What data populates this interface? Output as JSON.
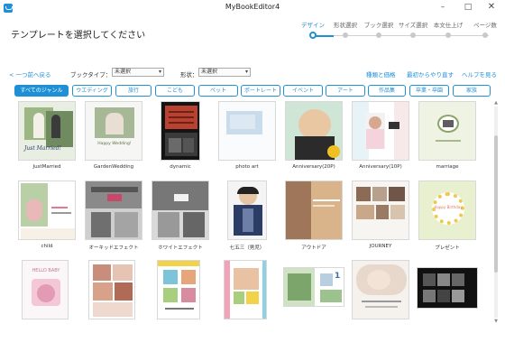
{
  "window": {
    "title": "MyBookEditor4",
    "minimize": "–",
    "maximize": "□",
    "close": "✕",
    "icon": "app-icon"
  },
  "page_title": "テンプレートを選択してください",
  "steps": [
    {
      "label": "デザイン",
      "active": true
    },
    {
      "label": "形状選択",
      "active": false
    },
    {
      "label": "ブック選択",
      "active": false
    },
    {
      "label": "サイズ選択",
      "active": false
    },
    {
      "label": "本文仕上げ",
      "active": false
    },
    {
      "label": "ページ数",
      "active": false
    }
  ],
  "toolbar": {
    "back": "< 一つ前へ戻る",
    "book_type_label": "ブックタイプ：",
    "book_type_value": "未選択",
    "shape_label": "形状：",
    "shape_value": "未選択",
    "link_price": "種類と価格",
    "link_redo": "最初からやり直す",
    "link_help": "ヘルプを見る"
  },
  "genres": [
    {
      "label": "すべてのジャンル",
      "active": true
    },
    {
      "label": "ウエディング",
      "active": false
    },
    {
      "label": "旅行",
      "active": false
    },
    {
      "label": "こども",
      "active": false
    },
    {
      "label": "ペット",
      "active": false
    },
    {
      "label": "ポートレート",
      "active": false
    },
    {
      "label": "イベント",
      "active": false
    },
    {
      "label": "アート",
      "active": false
    },
    {
      "label": "作品集",
      "active": false
    },
    {
      "label": "卒業・卒園",
      "active": false
    },
    {
      "label": "家族",
      "active": false
    }
  ],
  "templates": [
    {
      "name": "JustMarried",
      "thumb_text": "Just Married!"
    },
    {
      "name": "GardenWedding",
      "thumb_text": "Happy Wedding!"
    },
    {
      "name": "dynamic",
      "thumb_text": ""
    },
    {
      "name": "photo art",
      "thumb_text": ""
    },
    {
      "name": "Anniversary(20P)",
      "thumb_text": ""
    },
    {
      "name": "Anniversary(10P)",
      "thumb_text": ""
    },
    {
      "name": "marriage",
      "thumb_text": ""
    },
    {
      "name": "child",
      "thumb_text": ""
    },
    {
      "name": "オーキッドエフェクト",
      "thumb_text": ""
    },
    {
      "name": "ホワイトエフェクト",
      "thumb_text": ""
    },
    {
      "name": "七五三（男児）",
      "thumb_text": ""
    },
    {
      "name": "アウトドア",
      "thumb_text": ""
    },
    {
      "name": "JOURNEY",
      "thumb_text": ""
    },
    {
      "name": "プレゼント",
      "thumb_text": "Happy Birthday"
    },
    {
      "name": "",
      "thumb_text": "HELLO BABY"
    },
    {
      "name": "",
      "thumb_text": ""
    },
    {
      "name": "",
      "thumb_text": ""
    },
    {
      "name": "",
      "thumb_text": ""
    },
    {
      "name": "",
      "thumb_text": "1"
    },
    {
      "name": "",
      "thumb_text": ""
    },
    {
      "name": "",
      "thumb_text": ""
    }
  ],
  "colors": {
    "accent": "#1f8fd6"
  }
}
